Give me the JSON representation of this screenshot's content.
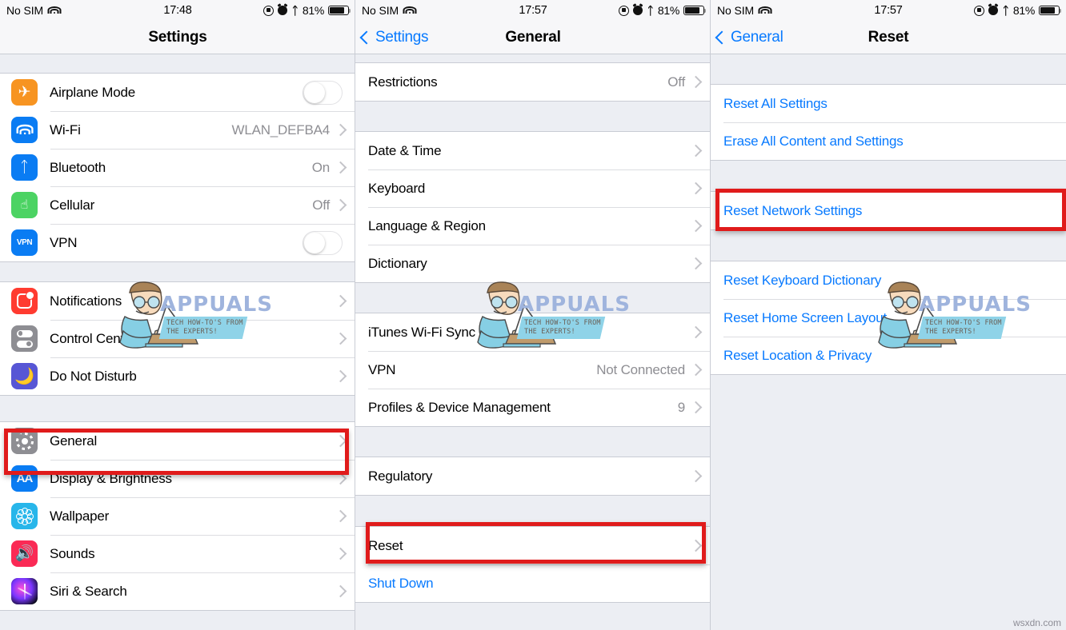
{
  "status_bar": {
    "carrier": "No SIM",
    "wifi_icon": "wifi-icon",
    "time_panel1": "17:48",
    "time_panel2": "17:57",
    "time_panel3": "17:57",
    "rotation_lock_icon": "rotation-lock-icon",
    "alarm_icon": "alarm-icon",
    "bluetooth_icon": "bluetooth-icon",
    "battery_percent": "81%",
    "battery_icon": "battery-icon"
  },
  "colors": {
    "accent_blue": "#087aff",
    "highlight_red": "#e01b1b",
    "group_bg": "#eceef3",
    "value_gray": "#8e8e93"
  },
  "panel1": {
    "nav": {
      "title": "Settings"
    },
    "group1": [
      {
        "label": "Airplane Mode",
        "icon": "airplane-icon",
        "control": "toggle",
        "toggle_on": false
      },
      {
        "label": "Wi-Fi",
        "icon": "wifi-icon",
        "value": "WLAN_DEFBA4",
        "control": "chevron"
      },
      {
        "label": "Bluetooth",
        "icon": "bluetooth-icon",
        "value": "On",
        "control": "chevron"
      },
      {
        "label": "Cellular",
        "icon": "cellular-icon",
        "value": "Off",
        "control": "chevron"
      },
      {
        "label": "VPN",
        "icon": "vpn-icon",
        "control": "toggle",
        "toggle_on": false
      }
    ],
    "group2": [
      {
        "label": "Notifications",
        "icon": "notifications-icon",
        "control": "chevron"
      },
      {
        "label": "Control Center",
        "icon": "control-center-icon",
        "control": "chevron"
      },
      {
        "label": "Do Not Disturb",
        "icon": "do-not-disturb-icon",
        "control": "chevron"
      }
    ],
    "group3": [
      {
        "label": "General",
        "icon": "gear-icon",
        "control": "chevron",
        "highlighted": true
      },
      {
        "label": "Display & Brightness",
        "icon": "display-brightness-icon",
        "control": "chevron"
      },
      {
        "label": "Wallpaper",
        "icon": "wallpaper-icon",
        "control": "chevron"
      },
      {
        "label": "Sounds",
        "icon": "sounds-icon",
        "control": "chevron"
      },
      {
        "label": "Siri & Search",
        "icon": "siri-icon",
        "control": "chevron"
      }
    ],
    "vpn_icon_text": "VPN",
    "display_icon_text": "AA"
  },
  "panel2": {
    "nav": {
      "back_label": "Settings",
      "title": "General"
    },
    "group1": [
      {
        "label": "Restrictions",
        "value": "Off",
        "control": "chevron"
      }
    ],
    "group2": [
      {
        "label": "Date & Time",
        "control": "chevron"
      },
      {
        "label": "Keyboard",
        "control": "chevron"
      },
      {
        "label": "Language & Region",
        "control": "chevron"
      },
      {
        "label": "Dictionary",
        "control": "chevron"
      }
    ],
    "group3": [
      {
        "label": "iTunes Wi-Fi Sync",
        "control": "chevron"
      },
      {
        "label": "VPN",
        "value": "Not Connected",
        "control": "chevron"
      },
      {
        "label": "Profiles & Device Management",
        "value": "9",
        "control": "chevron"
      }
    ],
    "group4": [
      {
        "label": "Regulatory",
        "control": "chevron"
      }
    ],
    "group5": [
      {
        "label": "Reset",
        "control": "chevron",
        "highlighted": true
      },
      {
        "label": "Shut Down",
        "control": "none",
        "blue": true
      }
    ]
  },
  "panel3": {
    "nav": {
      "back_label": "General",
      "title": "Reset"
    },
    "group1": [
      {
        "label": "Reset All Settings",
        "blue": true
      },
      {
        "label": "Erase All Content and Settings",
        "blue": true
      }
    ],
    "group2": [
      {
        "label": "Reset Network Settings",
        "blue": true,
        "highlighted": true
      }
    ],
    "group3": [
      {
        "label": "Reset Keyboard Dictionary",
        "blue": true
      },
      {
        "label": "Reset Home Screen Layout",
        "blue": true
      },
      {
        "label": "Reset Location & Privacy",
        "blue": true
      }
    ]
  },
  "watermark": {
    "brand": "APPUALS",
    "tagline": "TECH HOW-TO'S FROM THE EXPERTS!",
    "site": "wsxdn.com"
  }
}
